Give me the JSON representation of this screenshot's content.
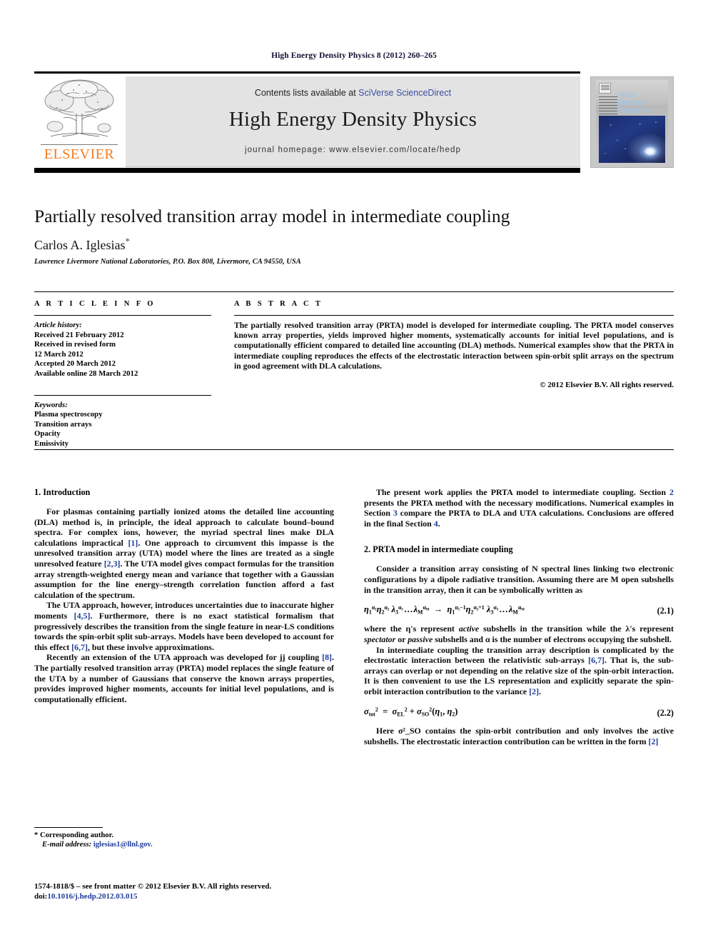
{
  "running_head": "High Energy Density Physics 8 (2012) 260–265",
  "masthead": {
    "contents_prefix": "Contents lists available at ",
    "contents_link": "SciVerse ScienceDirect",
    "journal_title": "High Energy Density Physics",
    "homepage": "journal homepage: www.elsevier.com/locate/hedp",
    "publisher_name": "ELSEVIER",
    "cover_title": "High Energy Density Physics",
    "link_color": "#3b4fa3",
    "brand_color": "#F47B20"
  },
  "article": {
    "title": "Partially resolved transition array model in intermediate coupling",
    "author": "Carlos A. Iglesias",
    "author_marker": "*",
    "affiliation": "Lawrence Livermore National Laboratories, P.O. Box 808, Livermore, CA 94550, USA"
  },
  "article_info": {
    "heading": "A R T I C L E   I N F O",
    "history_label": "Article history:",
    "history": [
      "Received 21 February 2012",
      "Received in revised form",
      "12 March 2012",
      "Accepted 20 March 2012",
      "Available online 28 March 2012"
    ],
    "keywords_label": "Keywords:",
    "keywords": [
      "Plasma spectroscopy",
      "Transition arrays",
      "Opacity",
      "Emissivity"
    ]
  },
  "abstract": {
    "heading": "A B S T R A C T",
    "text": "The partially resolved transition array (PRTA) model is developed for intermediate coupling. The PRTA model conserves known array properties, yields improved higher moments, systematically accounts for initial level populations, and is computationally efficient compared to detailed line accounting (DLA) methods. Numerical examples show that the PRTA in intermediate coupling reproduces the effects of the electrostatic interaction between spin-orbit split arrays on the spectrum in good agreement with DLA calculations.",
    "copyright": "© 2012 Elsevier B.V. All rights reserved."
  },
  "body": {
    "section1_heading": "1. Introduction",
    "p1_a": "For plasmas containing partially ionized atoms the detailed line accounting (DLA) method is, in principle, the ideal approach to calculate bound–bound spectra. For complex ions, however, the myriad spectral lines make DLA calculations impractical ",
    "p1_cite1": "[1]",
    "p1_b": ". One approach to circumvent this impasse is the unresolved transition array (UTA) model where the lines are treated as a single unresolved feature ",
    "p1_cite2": "[2,3]",
    "p1_c": ". The UTA model gives compact formulas for the transition array strength-weighted energy mean and variance that together with a Gaussian assumption for the line energy–strength correlation function afford a fast calculation of the spectrum.",
    "p2_a": "The UTA approach, however, introduces uncertainties due to inaccurate higher moments ",
    "p2_cite1": "[4,5]",
    "p2_b": ". Furthermore, there is no exact statistical formalism that progressively describes the transition from the single feature in near-LS conditions towards the spin-orbit split sub-arrays. Models have been developed to account for this effect ",
    "p2_cite2": "[6,7]",
    "p2_c": ", but these involve approximations.",
    "p3_a": "Recently an extension of the UTA approach was developed for jj coupling ",
    "p3_cite1": "[8]",
    "p3_b": ". The partially resolved transition array (PRTA) model replaces the single feature of the UTA by a number of Gaussians that conserve the known arrays properties, provides improved higher moments, accounts for initial level populations, and is computationally efficient.",
    "p4_a": "The present work applies the PRTA model to intermediate coupling. Section ",
    "p4_cite1": "2",
    "p4_b": " presents the PRTA method with the necessary modifications. Numerical examples in Section ",
    "p4_cite2": "3",
    "p4_c": " compare the PRTA to DLA and UTA calculations. Conclusions are offered in the final Section ",
    "p4_cite3": "4",
    "p4_d": ".",
    "section2_heading": "2. PRTA model in intermediate coupling",
    "p5": "Consider a transition array consisting of N spectral lines linking two electronic configurations by a dipole radiative transition. Assuming there are M open subshells in the transition array, then it can be symbolically written as",
    "eq21_number": "(2.1)",
    "eq21_text": "η₁^α₁ η₂^α₂ λ₃^α₃ … λ_M^α_M → η₁^(α₁−1) η₂^(α₂+1) λ₃^α₃ … λ_M^α_M",
    "p6_a": "where the η's represent ",
    "p6_em1": "active",
    "p6_b": " subshells in the transition while the λ's represent ",
    "p6_em2": "spectator",
    "p6_c": " or ",
    "p6_em3": "passive",
    "p6_d": " subshells and α is the number of electrons occupying the subshell.",
    "p7_a": "In intermediate coupling the transition array description is complicated by the electrostatic interaction between the relativistic sub-arrays ",
    "p7_cite1": "[6,7]",
    "p7_b": ". That is, the sub-arrays can overlap or not depending on the relative size of the spin-orbit interaction. It is then convenient to use the LS representation and explicitly separate the spin-orbit interaction contribution to the variance ",
    "p7_cite2": "[2]",
    "p7_c": ".",
    "eq22_number": "(2.2)",
    "eq22_text": "σ²_tot = σ²_EL + σ²_SO(η₁, η₂)",
    "p8_a": "Here σ²_SO contains the spin-orbit contribution and only involves the active subshells. The electrostatic interaction contribution can be written in the form ",
    "p8_cite1": "[2]"
  },
  "footnote": {
    "marker": "*",
    "corresponding": " Corresponding author.",
    "email_label": "E-mail address:",
    "email": "iglesias1@llnl.gov."
  },
  "footer": {
    "issn_line": "1574-1818/$ – see front matter © 2012 Elsevier B.V. All rights reserved.",
    "doi_prefix": "doi:",
    "doi": "10.1016/j.hedp.2012.03.015"
  }
}
